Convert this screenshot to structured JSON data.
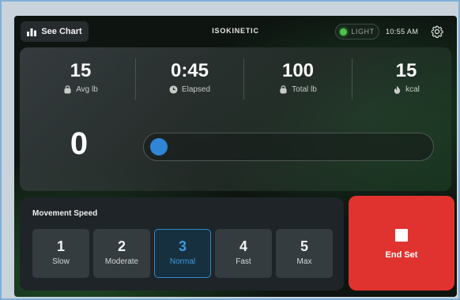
{
  "header": {
    "see_chart_label": "See Chart",
    "mode_title": "ISOKINETIC",
    "theme_label": "LIGHT",
    "time": "10:55 AM"
  },
  "stats": {
    "avg": {
      "value": "15",
      "label": "Avg lb",
      "icon": "kettlebell-icon"
    },
    "elapsed": {
      "value": "0:45",
      "label": "Elapsed",
      "icon": "clock-icon"
    },
    "total": {
      "value": "100",
      "label": "Total lb",
      "icon": "kettlebell-icon"
    },
    "kcal": {
      "value": "15",
      "label": "kcal",
      "icon": "flame-icon"
    }
  },
  "force": {
    "value": "0",
    "slider_fraction": 0.0
  },
  "speed": {
    "title": "Movement Speed",
    "options": [
      {
        "num": "1",
        "label": "Slow"
      },
      {
        "num": "2",
        "label": "Moderate"
      },
      {
        "num": "3",
        "label": "Normal"
      },
      {
        "num": "4",
        "label": "Fast"
      },
      {
        "num": "5",
        "label": "Max"
      }
    ],
    "selected_index": 2
  },
  "end_set": {
    "label": "End Set"
  },
  "colors": {
    "accent_blue": "#2f86d6",
    "end_red": "#e0332f",
    "light_indicator": "#4cc24a"
  }
}
